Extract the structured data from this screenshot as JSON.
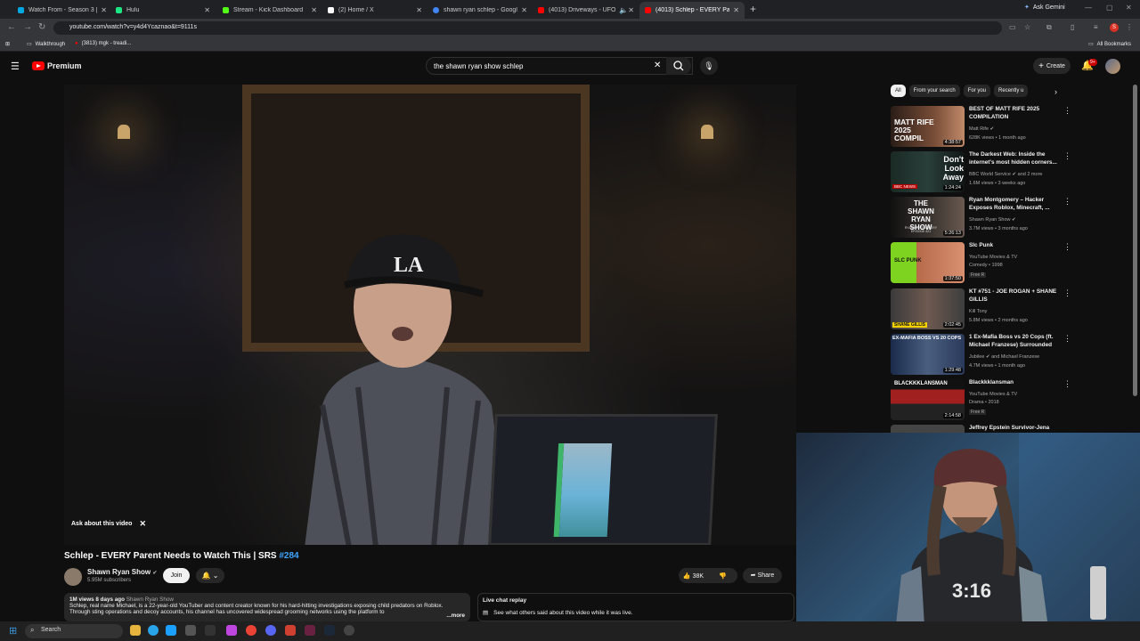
{
  "browser": {
    "tabs": [
      {
        "title": "Watch From - Season 3 | Prime",
        "color": "#00a8e1"
      },
      {
        "title": "Hulu",
        "color": "#1ce783"
      },
      {
        "title": "Stream - Kick Dashboard",
        "color": "#53fc18"
      },
      {
        "title": "(2) Home / X",
        "color": "#ffffff"
      },
      {
        "title": "shawn ryan schlep - Google Se",
        "color": "#4285f4"
      },
      {
        "title": "(4013) Driveways - UFOs in",
        "color": "#ff0000"
      },
      {
        "title": "(4013) Schlep - EVERY Parent N",
        "color": "#ff0000"
      }
    ],
    "ask_gemini": "Ask Gemini",
    "url": "youtube.com/watch?v=y4d4Ycaznao&t=9111s",
    "profile_initial": "S",
    "bookmarks": [
      {
        "label": "Walkthrough"
      },
      {
        "label": "(3813) mgk - treadi..."
      }
    ],
    "all_bookmarks": "All Bookmarks"
  },
  "youtube": {
    "logo": "Premium",
    "search_value": "the shawn ryan show schlep",
    "create": "Create",
    "notifications": "9+"
  },
  "video": {
    "ask_label": "Ask about this video",
    "title": "Schlep - EVERY Parent Needs to Watch This | SRS",
    "title_tag": "#284",
    "channel": "Shawn Ryan Show",
    "subscribers": "5.95M subscribers",
    "join": "Join",
    "likes": "38K",
    "share": "Share",
    "views_meta": "1M views  8 days ago",
    "desc_channel": "Shawn Ryan Show",
    "description": "Schlep, real name Michael, is a 22-year-old YouTuber and content creator known for his hard-hitting investigations exposing child predators on Roblox. Through sting operations and decoy accounts, his channel has uncovered widespread grooming networks using the platform to",
    "more": "...more",
    "live_chat_title": "Live chat replay",
    "live_chat_text": "See what others said about this video while it was live."
  },
  "sidebar": {
    "chips": [
      "All",
      "From your search",
      "For you",
      "Recently u"
    ],
    "recommendations": [
      {
        "title": "BEST OF MATT RIFE 2025 COMPILATION",
        "channel": "Matt Rife",
        "meta": "628K views • 1 month ago",
        "duration": "4:38:57",
        "thumb": "matt-rife",
        "verified": true
      },
      {
        "title": "The Darkest Web: Inside the internet's most hidden corners...",
        "channel": "BBC World Service",
        "channel_extra": "and 2 more",
        "meta": "1.6M views • 3 weeks ago",
        "duration": "1:24:24",
        "thumb": "darkest-web",
        "verified": true
      },
      {
        "title": "Ryan Montgomery – Hacker Exposes Roblox, Minecraft, ...",
        "channel": "Shawn Ryan Show",
        "meta": "3.7M views • 3 months ago",
        "duration": "5:26:13",
        "thumb": "shawn-ryan",
        "verified": true
      },
      {
        "title": "Slc Punk",
        "channel": "YouTube Movies & TV",
        "meta": "Comedy • 1998",
        "duration": "1:37:50",
        "thumb": "slc-punk",
        "badges": "Free  R"
      },
      {
        "title": "KT #751 - JOE ROGAN + SHANE GILLIS",
        "channel": "Kill Tony",
        "meta": "5.8M views • 2 months ago",
        "duration": "2:02:45",
        "thumb": "kill-tony"
      },
      {
        "title": "1 Ex-Mafia Boss vs 20 Cops (ft. Michael Franzese) Surrounded",
        "channel": "Jubilee",
        "channel_extra": "and Michael Franzese",
        "meta": "4.7M views • 1 month ago",
        "duration": "1:29:48",
        "thumb": "mafia",
        "verified": true
      },
      {
        "title": "Blackkklansman",
        "channel": "YouTube Movies & TV",
        "meta": "Drama • 2018",
        "duration": "2:14:58",
        "thumb": "blackkklansman",
        "badges": "Free  R"
      },
      {
        "title": "Jeffrey Epstein Survivor-Jena",
        "thumb": "epstein"
      }
    ],
    "thumb_text": {
      "matt": "MATT RIFE 2025 COMPIL",
      "dark": "Don't Look Away",
      "dark_badge": "BBC NEWS",
      "shawn": "THE SHAWN RYAN SHOW",
      "shawn_sub": "RYAN MONTGOMERY EPISODE #21",
      "slc": "SLC PUNK",
      "tony": "SHANE GILLIS",
      "mafia": "EX-MAFIA BOSS VS 20 COPS",
      "klan": "BLACKKKLANSMAN"
    }
  },
  "taskbar": {
    "search": "Search"
  }
}
